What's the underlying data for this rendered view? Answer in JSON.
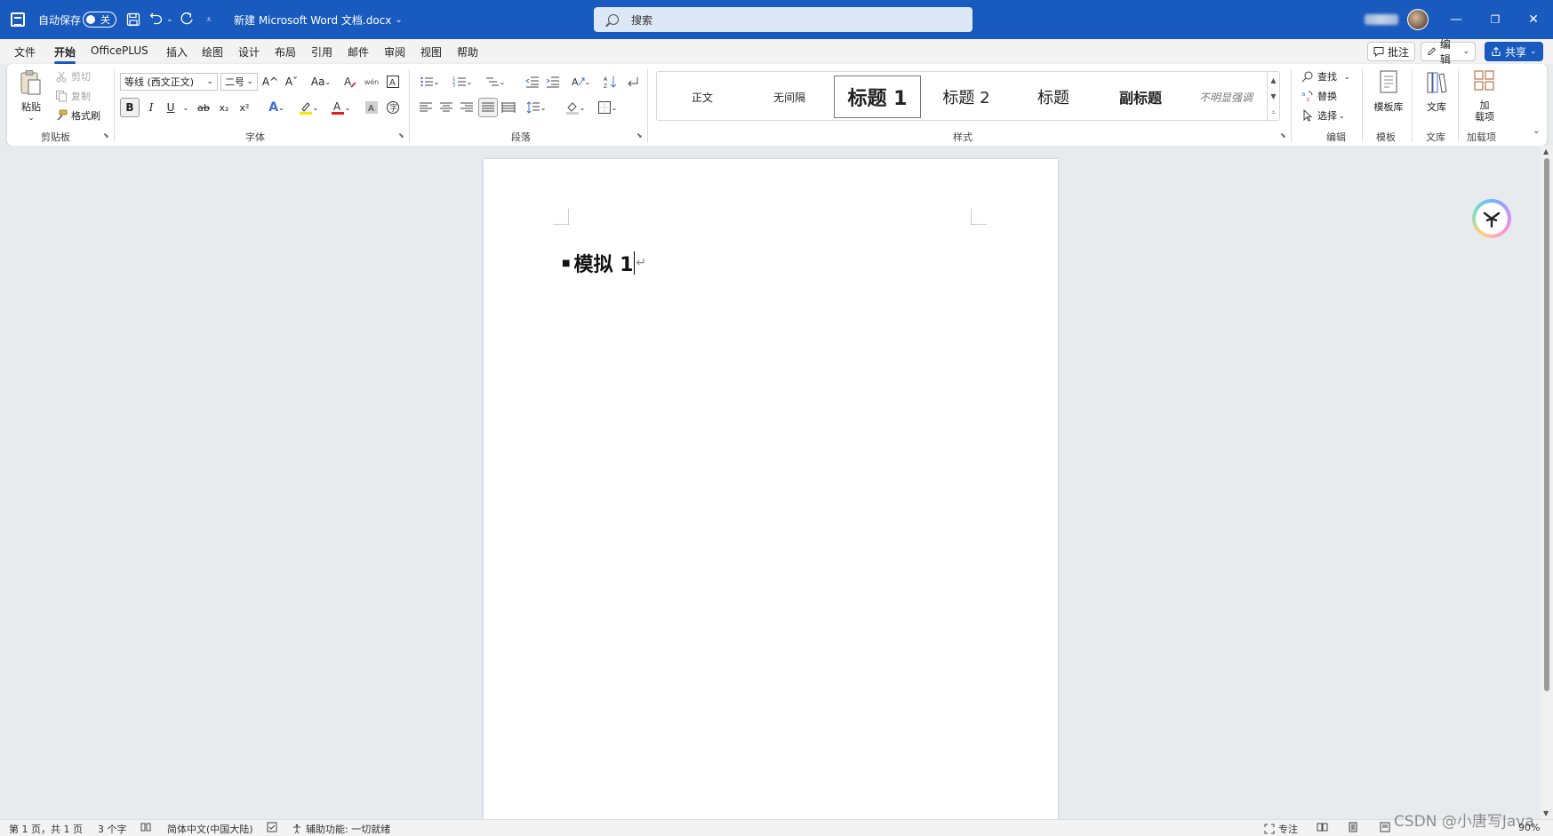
{
  "titlebar": {
    "autosave_label": "自动保存",
    "autosave_state": "关",
    "document_title": "新建 Microsoft Word 文档.docx",
    "search_placeholder": "搜索",
    "window_controls": {
      "minimize": "—",
      "restore": "❐",
      "close": "✕"
    }
  },
  "menu": {
    "tabs": [
      "文件",
      "开始",
      "OfficePLUS",
      "插入",
      "绘图",
      "设计",
      "布局",
      "引用",
      "邮件",
      "审阅",
      "视图",
      "帮助"
    ],
    "active_tab": "开始",
    "comment_label": "批注",
    "edit_label": "编辑",
    "share_label": "共享"
  },
  "ribbon": {
    "clipboard": {
      "paste_label": "粘贴",
      "cut_label": "剪切",
      "copy_label": "复制",
      "format_painter_label": "格式刷",
      "group_label": "剪贴板"
    },
    "font": {
      "font_name": "等线 (西文正文)",
      "font_size": "二号",
      "group_label": "字体",
      "bold": "B",
      "italic": "I",
      "underline": "U",
      "strike": "ab",
      "subscript": "x₂",
      "superscript": "x²",
      "case": "Aa",
      "grow": "A^",
      "shrink": "Aˇ"
    },
    "paragraph": {
      "group_label": "段落"
    },
    "styles": {
      "group_label": "样式",
      "items": [
        "正文",
        "无间隔",
        "标题 1",
        "标题 2",
        "标题",
        "副标题",
        "不明显强调"
      ],
      "selected": "标题 1"
    },
    "editing": {
      "find_label": "查找",
      "replace_label": "替换",
      "select_label": "选择",
      "group_label": "编辑"
    },
    "template": {
      "button_label": "模板库",
      "group_label": "模板"
    },
    "library": {
      "button_label": "文库",
      "group_label": "文库"
    },
    "addins": {
      "button_label": "加\n载项",
      "button_line1": "加",
      "button_line2": "载项",
      "group_label": "加载项"
    }
  },
  "document": {
    "heading_text": "模拟 1",
    "paragraph_mark": "↵"
  },
  "statusbar": {
    "page_info": "第 1 页，共 1 页",
    "word_count": "3 个字",
    "language": "简体中文(中国大陆)",
    "accessibility": "辅助功能: 一切就绪",
    "focus_label": "专注",
    "zoom": "90%"
  },
  "watermark": "CSDN @小唐写Java"
}
